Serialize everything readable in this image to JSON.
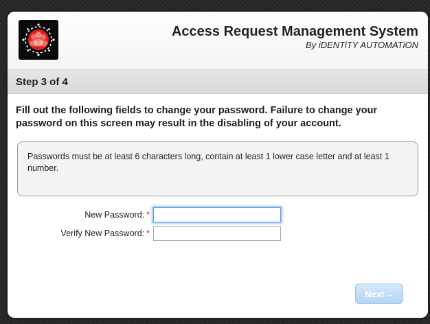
{
  "header": {
    "title": "Access Request Management System",
    "subtitle": "By iDENTiTY AUTOMATiON",
    "logo_icon": "users-group-logo-icon"
  },
  "step": {
    "label": "Step 3 of 4"
  },
  "instructions": "Fill out the following fields to change your password. Failure to change your password on this screen may result in the disabling of your account.",
  "password_rules": "Passwords must be at least 6 characters long, contain at least 1 lower case letter and at least 1 number.",
  "form": {
    "new_password": {
      "label": "New Password:",
      "required_marker": "*",
      "value": "",
      "placeholder": ""
    },
    "verify_password": {
      "label": "Verify New Password:",
      "required_marker": "*",
      "value": "",
      "placeholder": ""
    }
  },
  "buttons": {
    "next_label": "Next→"
  },
  "colors": {
    "required": "#d9211e",
    "button_accent": "#b5d4f3",
    "focus_ring": "#5b9ddc",
    "logo_red": "#e2231a"
  }
}
